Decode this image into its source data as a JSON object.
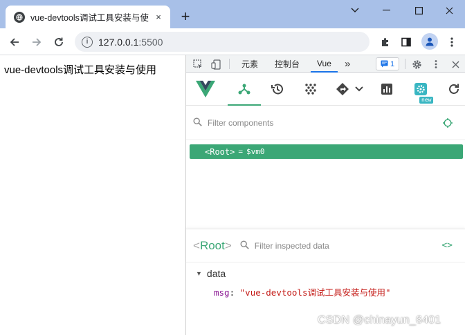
{
  "browser": {
    "tab_title": "vue-devtools调试工具安装与使",
    "tab_close": "×",
    "new_tab": "+",
    "window_controls": {
      "minimize": "—",
      "maximize": "☐",
      "close": "✕",
      "dropdown": "⌄"
    },
    "url_host": "127.0.0.1",
    "url_port": ":5500"
  },
  "page": {
    "body_text": "vue-devtools调试工具安装与使用"
  },
  "devtools": {
    "tabs": [
      {
        "label": "元素"
      },
      {
        "label": "控制台"
      },
      {
        "label": "Vue"
      }
    ],
    "more_tabs": "»",
    "message_count": "1",
    "vue": {
      "new_badge": "new",
      "filter_components_placeholder": "Filter components",
      "root_component": "<Root>",
      "root_eq": "=",
      "root_var": "$vm0",
      "inspector_title_open": "<",
      "inspector_title_name": "Root",
      "inspector_title_close": ">",
      "filter_inspected_placeholder": "Filter inspected data",
      "code_icon": "<>",
      "data_section": "data",
      "data_items": [
        {
          "key": "msg",
          "value": "\"vue-devtools调试工具安装与使用\""
        }
      ]
    }
  },
  "watermark": "CSDN @chinayun_6401",
  "colors": {
    "vue_green": "#3ba776",
    "titlebar": "#a8c0e8",
    "devtools_tab_active": "#1a73e8"
  }
}
